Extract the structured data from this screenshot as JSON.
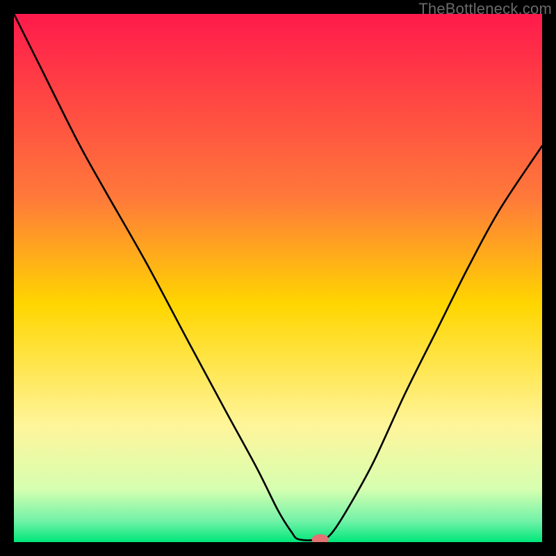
{
  "watermark": "TheBottleneck.com",
  "chart_data": {
    "type": "line",
    "title": "",
    "xlabel": "",
    "ylabel": "",
    "xlim": [
      0,
      100
    ],
    "ylim": [
      0,
      100
    ],
    "grid": false,
    "legend": false,
    "background_gradient_stops": [
      {
        "offset": 0.0,
        "color": "#ff1a4b"
      },
      {
        "offset": 0.35,
        "color": "#ff7a3a"
      },
      {
        "offset": 0.55,
        "color": "#ffd600"
      },
      {
        "offset": 0.78,
        "color": "#fff59b"
      },
      {
        "offset": 0.9,
        "color": "#d6ffb0"
      },
      {
        "offset": 0.96,
        "color": "#71f2a8"
      },
      {
        "offset": 1.0,
        "color": "#00e77a"
      }
    ],
    "curve_points": [
      {
        "x": 0.0,
        "y": 100.0
      },
      {
        "x": 5.0,
        "y": 90.0
      },
      {
        "x": 12.0,
        "y": 76.0
      },
      {
        "x": 17.0,
        "y": 67.0
      },
      {
        "x": 25.0,
        "y": 53.0
      },
      {
        "x": 33.0,
        "y": 38.0
      },
      {
        "x": 40.0,
        "y": 25.0
      },
      {
        "x": 46.0,
        "y": 14.0
      },
      {
        "x": 50.0,
        "y": 6.0
      },
      {
        "x": 52.5,
        "y": 2.0
      },
      {
        "x": 54.0,
        "y": 0.5
      },
      {
        "x": 58.0,
        "y": 0.5
      },
      {
        "x": 60.0,
        "y": 1.5
      },
      {
        "x": 63.0,
        "y": 6.0
      },
      {
        "x": 68.0,
        "y": 15.0
      },
      {
        "x": 74.0,
        "y": 28.0
      },
      {
        "x": 80.0,
        "y": 40.0
      },
      {
        "x": 86.0,
        "y": 52.0
      },
      {
        "x": 92.0,
        "y": 63.0
      },
      {
        "x": 100.0,
        "y": 75.0
      }
    ],
    "marker": {
      "x": 58.0,
      "y": 0.5,
      "color": "#e57373",
      "rx": 1.6,
      "ry": 1.0
    }
  }
}
